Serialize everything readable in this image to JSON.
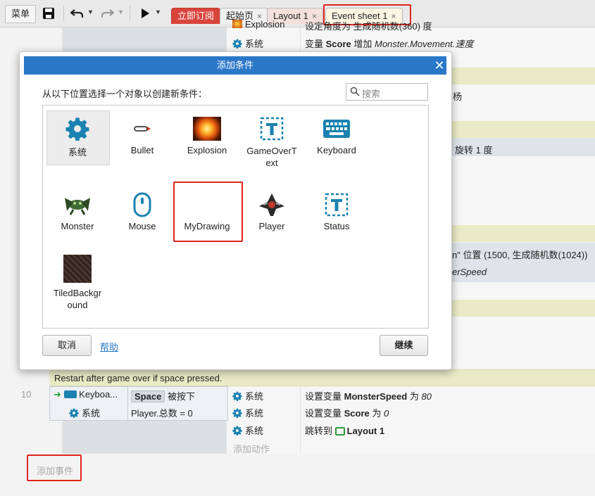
{
  "toolbar": {
    "menu_label": "菜单",
    "tabs": [
      {
        "label": "立即订阅",
        "closable": false
      },
      {
        "label": "起始页",
        "closable": true
      },
      {
        "label": "Layout 1",
        "closable": true
      },
      {
        "label": "Event sheet 1",
        "closable": true
      }
    ],
    "close_glyph": "×"
  },
  "sheet": {
    "top_rows": [
      {
        "object": "Explosion",
        "action": "设定角度为 生成随机数(360) 度"
      },
      {
        "object": "系统",
        "action_prefix": "变量 ",
        "action_bold": "Score",
        "action_mid": " 增加 ",
        "action_italic": "Monster.Movement.速度"
      }
    ],
    "peek_fragments": [
      "杨",
      "旋转 1 度",
      "n\" 位置 (1500, 生成随机数(1024))",
      "erSpeed"
    ],
    "comment": "Restart after game over if space pressed.",
    "event_number": "10",
    "conditions": [
      {
        "object": "Keyboa...",
        "key": "Space",
        "text": "被按下"
      },
      {
        "object": "系统",
        "text": "Player.总数 = 0"
      }
    ],
    "actions": [
      {
        "object": "系统",
        "prefix": "设置变量 ",
        "bold": "MonsterSpeed",
        "mid": " 为 ",
        "italic": "80"
      },
      {
        "object": "系统",
        "prefix": "设置变量 ",
        "bold": "Score",
        "mid": " 为 ",
        "italic": "0"
      },
      {
        "object": "系统",
        "prefix": "跳转到 ",
        "bold": "Layout 1",
        "mid": "",
        "italic": ""
      }
    ],
    "add_action": "添加动作",
    "add_event": "添加事件"
  },
  "dialog": {
    "title": "添加条件",
    "instruction": "从以下位置选择一个对象以创建新条件：",
    "search_placeholder": "搜索",
    "objects": [
      {
        "label": "系统",
        "icon": "gear-icon"
      },
      {
        "label": "Bullet",
        "icon": "bullet-icon"
      },
      {
        "label": "Explosion",
        "icon": "explosion-icon"
      },
      {
        "label": "GameOverT\next",
        "icon": "text-object-icon"
      },
      {
        "label": "Keyboard",
        "icon": "keyboard-icon"
      },
      {
        "label": "Monster",
        "icon": "monster-icon"
      },
      {
        "label": "Mouse",
        "icon": "mouse-icon"
      },
      {
        "label": "MyDrawing",
        "icon": "drawing-icon"
      },
      {
        "label": "Player",
        "icon": "player-ship-icon"
      },
      {
        "label": "Status",
        "icon": "text-object-icon"
      },
      {
        "label": "TiledBackgr\nound",
        "icon": "tiled-background-icon"
      }
    ],
    "cancel_label": "取消",
    "help_label": "帮助",
    "continue_label": "继续"
  },
  "colors": {
    "accent": "#2b78c8",
    "highlight": "#e0241b",
    "subscribe_tab": "#d9453d",
    "comment_band": "#e9ebc6"
  }
}
